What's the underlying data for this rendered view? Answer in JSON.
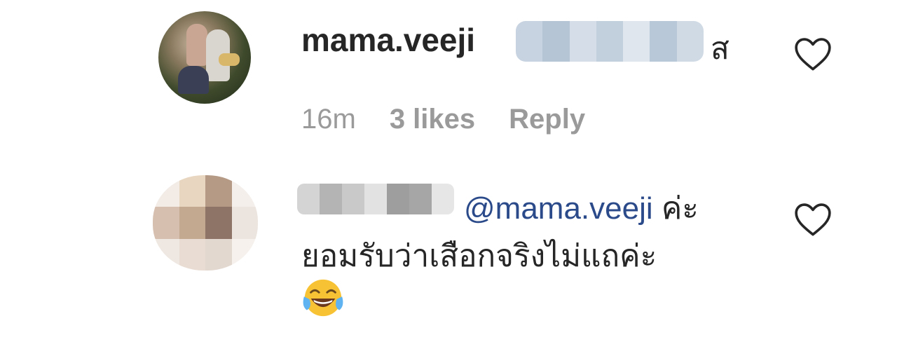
{
  "comments": [
    {
      "username": "mama.veeji",
      "text": "ส",
      "time": "16m",
      "likes": "3 likes",
      "reply_label": "Reply",
      "icon": "heart-outline-icon"
    },
    {
      "mention": "@mama.veeji",
      "text_line1_suffix": " ค่ะ",
      "text_line2": "ยอมรับว่าเสือกจริงไม่แถค่ะ",
      "emoji": "face-with-tears-of-joy",
      "icon": "heart-outline-icon"
    }
  ],
  "colors": {
    "text": "#262626",
    "meta": "#9a9a9a",
    "mention": "#2b4a8a"
  }
}
